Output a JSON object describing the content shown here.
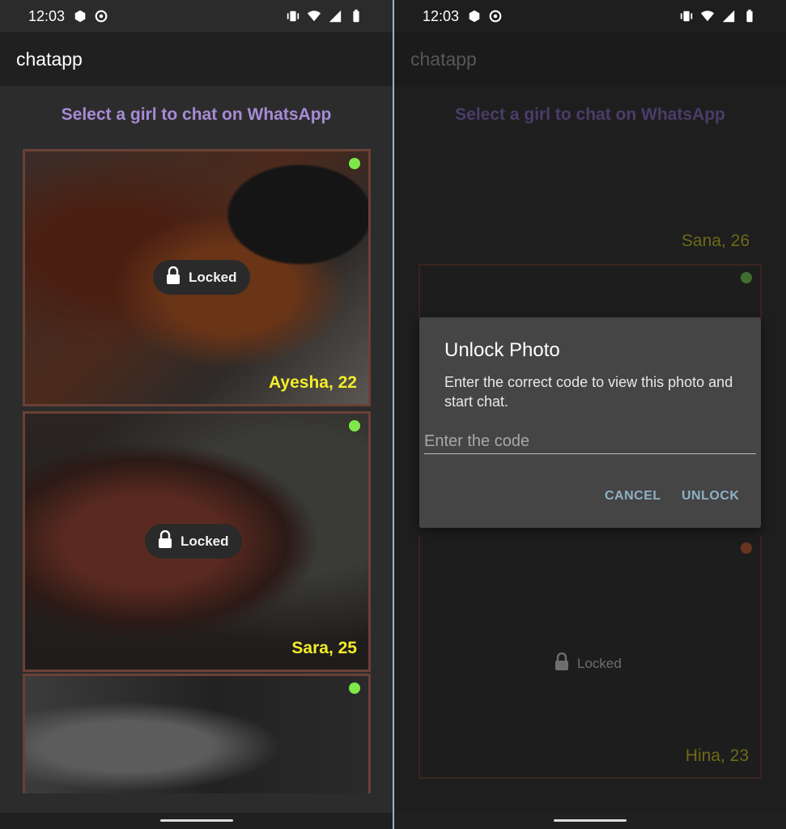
{
  "left": {
    "status_time": "12:03",
    "title": "chatapp",
    "subtitle": "Select a girl to chat on WhatsApp",
    "cards": [
      {
        "name": "Ayesha, 22",
        "locked_label": "Locked",
        "online": true
      },
      {
        "name": "Sara, 25",
        "locked_label": "Locked",
        "online": true
      },
      {
        "online": true
      }
    ]
  },
  "right": {
    "status_time": "12:03",
    "title": "chatapp",
    "subtitle": "Select a girl to chat on WhatsApp",
    "visible_cards": [
      {
        "name": "Sana, 26"
      },
      {
        "name": "Hina, 23",
        "locked_label": "Locked"
      }
    ],
    "dialog": {
      "title": "Unlock Photo",
      "message": "Enter the correct code to view this photo and start chat.",
      "input_placeholder": "Enter the code",
      "input_value": "",
      "cancel_label": "CANCEL",
      "unlock_label": "UNLOCK"
    }
  },
  "colors": {
    "subtitle": "#a68bd6",
    "name": "#f3ec2a",
    "online": "#7ee84a",
    "dialog_button": "#8eb2c4"
  }
}
